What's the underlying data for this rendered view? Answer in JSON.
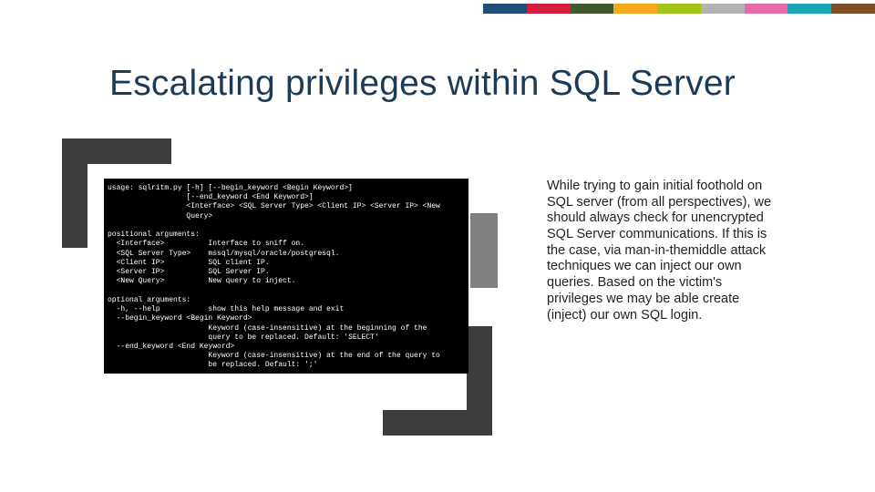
{
  "header": {
    "colors": [
      "#1f4e79",
      "#d31f3c",
      "#3f5a2c",
      "#f5a81b",
      "#a1c517",
      "#b3b3b3",
      "#e86aa6",
      "#1aa6b8",
      "#7f4f2a"
    ]
  },
  "title": "Escalating privileges within SQL Server",
  "terminal": {
    "lines": [
      "usage: sqlritm.py [-h] [--begin_keyword <Begin Keyword>]",
      "                  [--end_keyword <End Keyword>]",
      "                  <Interface> <SQL Server Type> <Client IP> <Server IP> <New",
      "                  Query>",
      "",
      "positional arguments:",
      "  <Interface>          Interface to sniff on.",
      "  <SQL Server Type>    mssql/mysql/oracle/postgresql.",
      "  <Client IP>          SQL client IP.",
      "  <Server IP>          SQL Server IP.",
      "  <New Query>          New query to inject.",
      "",
      "optional arguments:",
      "  -h, --help           show this help message and exit",
      "  --begin_keyword <Begin Keyword>",
      "                       Keyword (case-insensitive) at the beginning of the",
      "                       query to be replaced. Default: 'SELECT'",
      "  --end_keyword <End Keyword>",
      "                       Keyword (case-insensitive) at the end of the query to",
      "                       be replaced. Default: ';'"
    ]
  },
  "body": "While trying to gain initial foothold on SQL server (from all perspectives), we should always check for unencrypted SQL Server communications. If this is the case, via man-in-themiddle attack techniques we can inject our own queries. Based on the victim's privileges we may be able create (inject) our own SQL login."
}
